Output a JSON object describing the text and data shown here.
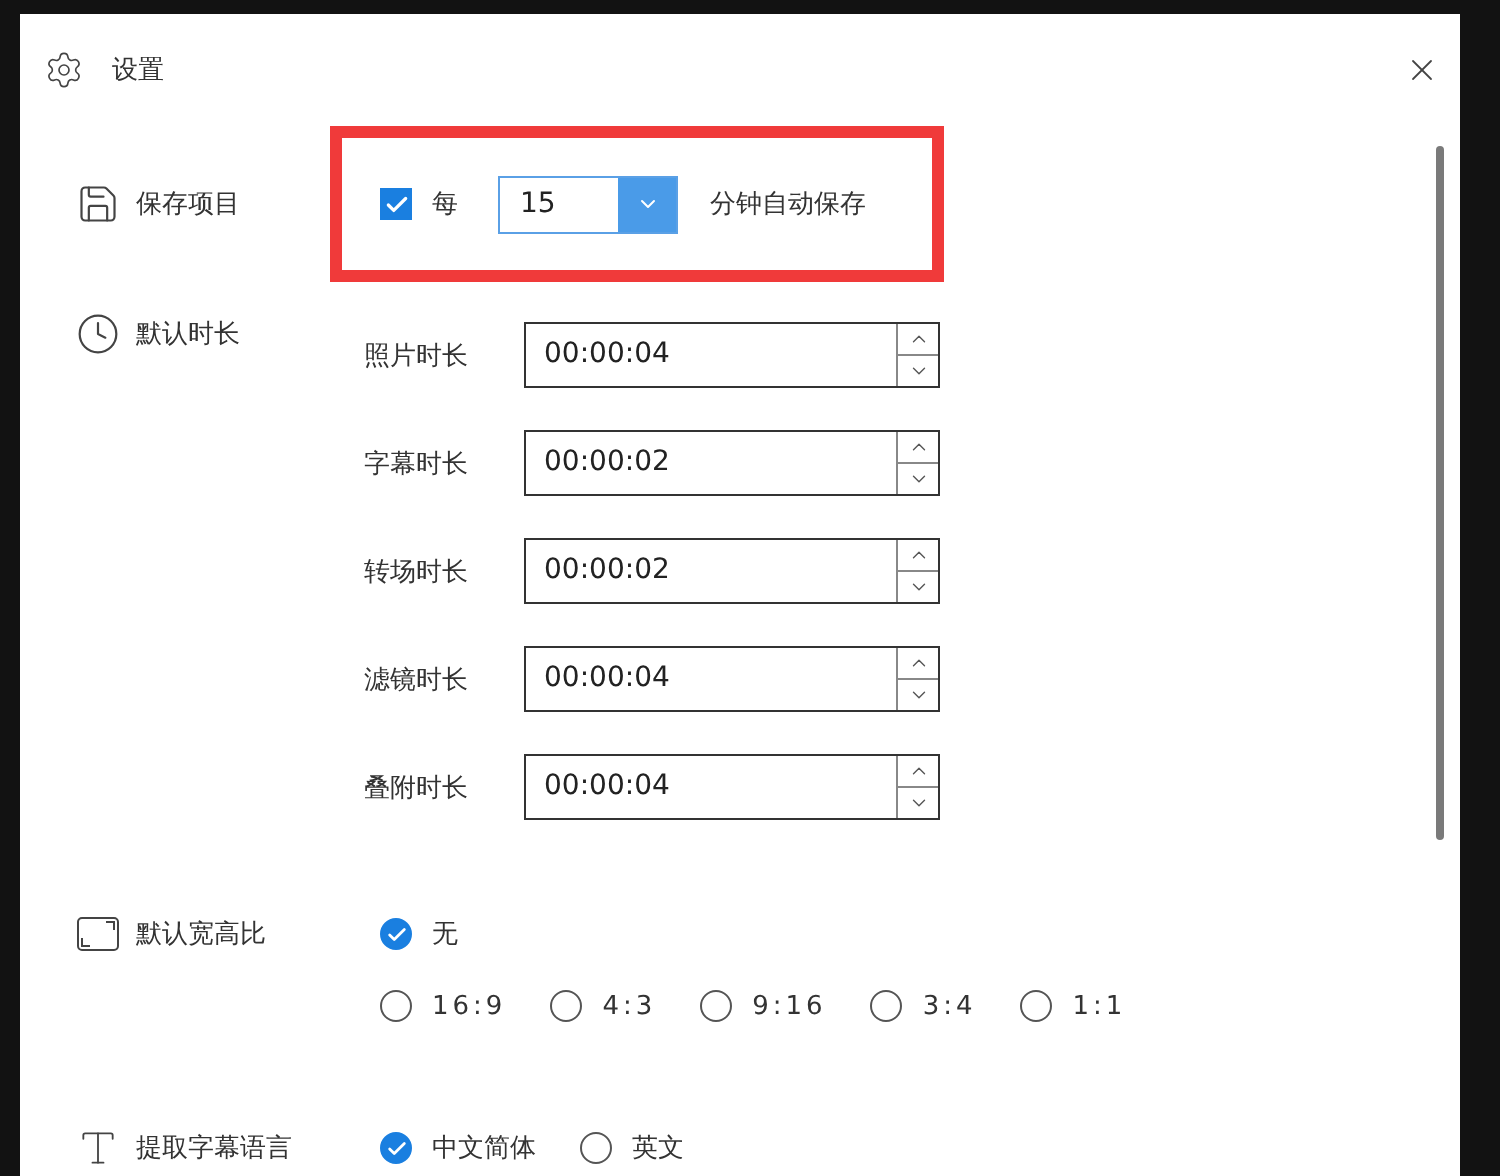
{
  "window": {
    "title": "设置"
  },
  "sections": [
    {
      "kind": "autosave",
      "label": "保存项目",
      "highlighted": true,
      "checkbox": {
        "label": "每",
        "checked": true
      },
      "interval": {
        "value": "15"
      },
      "suffix": "分钟自动保存"
    },
    {
      "kind": "durations",
      "label": "默认时长",
      "fields": [
        {
          "label": "照片时长",
          "value": "00:00:04"
        },
        {
          "label": "字幕时长",
          "value": "00:00:02"
        },
        {
          "label": "转场时长",
          "value": "00:00:02"
        },
        {
          "label": "滤镜时长",
          "value": "00:00:04"
        },
        {
          "label": "叠附时长",
          "value": "00:00:04"
        }
      ]
    },
    {
      "kind": "aspect",
      "label": "默认宽高比",
      "option_rows": [
        {
          "options": [
            {
              "label": "无",
              "selected": true
            }
          ]
        },
        {
          "options": [
            {
              "label": "16:9",
              "selected": false
            },
            {
              "label": "4:3",
              "selected": false
            },
            {
              "label": "9:16",
              "selected": false
            },
            {
              "label": "3:4",
              "selected": false
            },
            {
              "label": "1:1",
              "selected": false
            }
          ]
        }
      ]
    },
    {
      "kind": "language",
      "label": "提取字幕语言",
      "option_rows": [
        {
          "options": [
            {
              "label": "中文简体",
              "selected": true
            },
            {
              "label": "英文",
              "selected": false
            }
          ]
        }
      ]
    }
  ]
}
